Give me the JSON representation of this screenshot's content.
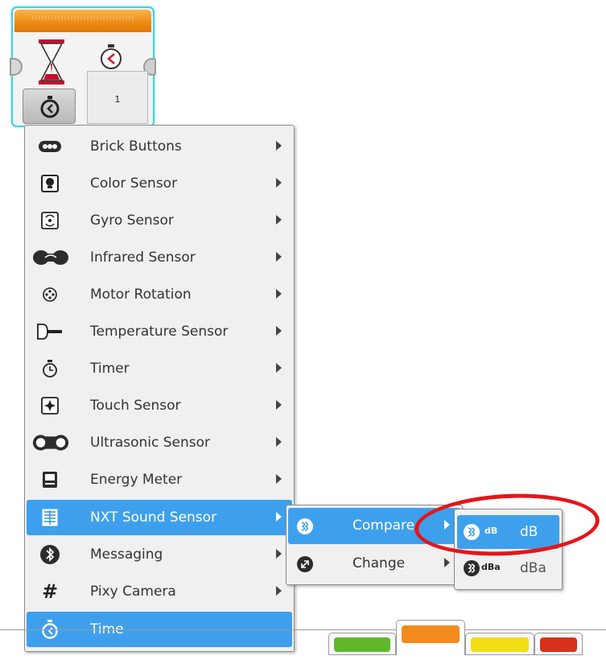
{
  "wait_block": {
    "parameter_value": "1",
    "colors": {
      "header": "#ec8a12",
      "selection_outline": "#3fd3e0"
    },
    "icons": [
      "hourglass-icon",
      "timer-icon",
      "mode-timer-icon"
    ]
  },
  "main_menu": {
    "items": [
      {
        "label": "Brick Buttons",
        "icon": "brick-buttons-icon",
        "has_submenu": true
      },
      {
        "label": "Color Sensor",
        "icon": "color-sensor-icon",
        "has_submenu": true
      },
      {
        "label": "Gyro Sensor",
        "icon": "gyro-sensor-icon",
        "has_submenu": true
      },
      {
        "label": "Infrared Sensor",
        "icon": "infrared-sensor-icon",
        "has_submenu": true
      },
      {
        "label": "Motor Rotation",
        "icon": "motor-rotation-icon",
        "has_submenu": true
      },
      {
        "label": "Temperature Sensor",
        "icon": "temperature-sensor-icon",
        "has_submenu": true
      },
      {
        "label": "Timer",
        "icon": "timer-icon",
        "has_submenu": true
      },
      {
        "label": "Touch Sensor",
        "icon": "touch-sensor-icon",
        "has_submenu": true
      },
      {
        "label": "Ultrasonic Sensor",
        "icon": "ultrasonic-sensor-icon",
        "has_submenu": true
      },
      {
        "label": "Energy Meter",
        "icon": "energy-meter-icon",
        "has_submenu": true
      },
      {
        "label": "NXT Sound Sensor",
        "icon": "nxt-sound-sensor-icon",
        "has_submenu": true,
        "highlighted": true
      },
      {
        "label": "Messaging",
        "icon": "bluetooth-icon",
        "has_submenu": true
      },
      {
        "label": "Pixy Camera",
        "icon": "hash-icon",
        "has_submenu": true
      },
      {
        "label": "Time",
        "icon": "time-icon",
        "has_submenu": false,
        "selected": true
      }
    ],
    "highlight_color": "#3ea0ec"
  },
  "sub_menu": {
    "items": [
      {
        "label": "Compare",
        "icon": "compare-icon",
        "highlighted": true
      },
      {
        "label": "Change",
        "icon": "change-icon"
      }
    ]
  },
  "sub2_menu": {
    "items": [
      {
        "label": "dB",
        "tag": "dB",
        "icon": "sound-db-icon",
        "highlighted": true
      },
      {
        "label": "dBa",
        "tag": "dBa",
        "icon": "sound-dba-icon"
      }
    ]
  },
  "palette_tabs": [
    {
      "color": "#5fb82c"
    },
    {
      "color": "#f28a1c",
      "active": true
    },
    {
      "color": "#f2de14"
    },
    {
      "color": "#d7321b"
    }
  ],
  "annotation": {
    "color": "#e3161a"
  }
}
